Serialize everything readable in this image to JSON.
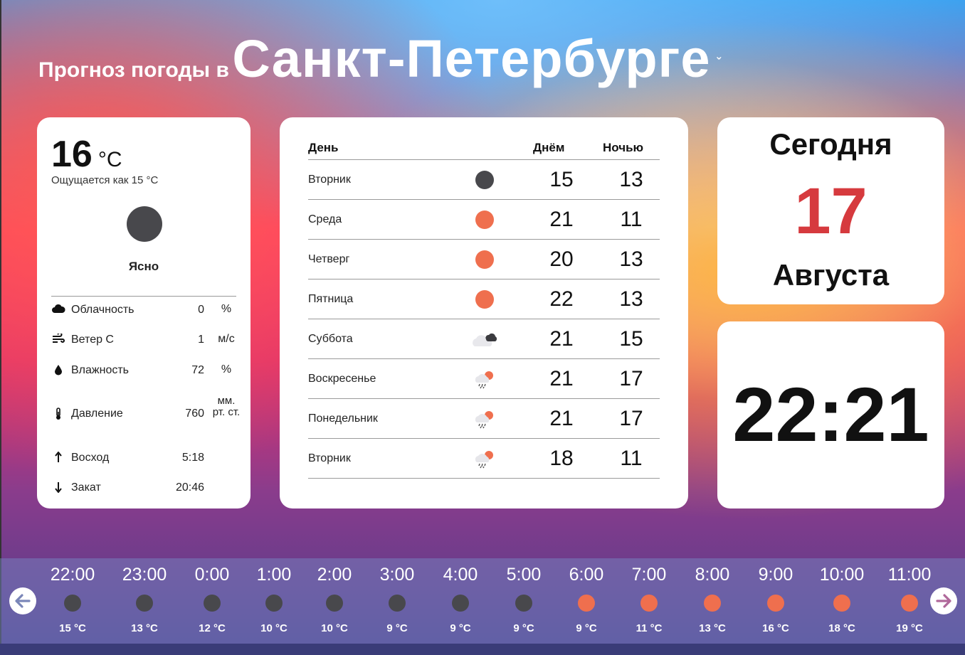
{
  "header": {
    "prefix": "Прогноз погоды в",
    "city": "Санкт-Петербурге",
    "chevron": "ˇ"
  },
  "current": {
    "temp": "16",
    "unit": "°C",
    "feels": "Ощущается как 15 °C",
    "condition": "Ясно",
    "icon": "moon-clear-icon",
    "details": [
      {
        "icon": "cloud-icon",
        "label": "Облачность",
        "value": "0",
        "unit": "%"
      },
      {
        "icon": "wind-icon",
        "label": "Ветер С",
        "value": "1",
        "unit": "м/с"
      },
      {
        "icon": "drop-icon",
        "label": "Влажность",
        "value": "72",
        "unit": "%"
      },
      {
        "icon": "thermometer-icon",
        "label": "Давление",
        "value": "760",
        "unit": "мм. рт. ст."
      },
      {
        "icon": "arrow-up-icon",
        "label": "Восход",
        "value": "5:18",
        "unit": ""
      },
      {
        "icon": "arrow-down-icon",
        "label": "Закат",
        "value": "20:46",
        "unit": ""
      }
    ]
  },
  "forecast": {
    "headers": {
      "day": "День",
      "daytime": "Днём",
      "night": "Ночью"
    },
    "rows": [
      {
        "day": "Вторник",
        "icon": "moon-icon",
        "d": "15",
        "n": "13"
      },
      {
        "day": "Среда",
        "icon": "sun-icon",
        "d": "21",
        "n": "11"
      },
      {
        "day": "Четверг",
        "icon": "sun-icon",
        "d": "20",
        "n": "13"
      },
      {
        "day": "Пятница",
        "icon": "sun-icon",
        "d": "22",
        "n": "13"
      },
      {
        "day": "Суббота",
        "icon": "cloudy-icon",
        "d": "21",
        "n": "15"
      },
      {
        "day": "Воскресенье",
        "icon": "rain-icon",
        "d": "21",
        "n": "17"
      },
      {
        "day": "Понедельник",
        "icon": "rain-icon",
        "d": "21",
        "n": "17"
      },
      {
        "day": "Вторник",
        "icon": "rain-icon",
        "d": "18",
        "n": "11"
      }
    ]
  },
  "date": {
    "today": "Сегодня",
    "day": "17",
    "month": "Августа"
  },
  "time": "22:21",
  "hourly": [
    {
      "time": "22:00",
      "icon": "moon-icon",
      "temp": "15 °C"
    },
    {
      "time": "23:00",
      "icon": "moon-icon",
      "temp": "13 °C"
    },
    {
      "time": "0:00",
      "icon": "moon-icon",
      "temp": "12 °C"
    },
    {
      "time": "1:00",
      "icon": "moon-icon",
      "temp": "10 °C"
    },
    {
      "time": "2:00",
      "icon": "moon-icon",
      "temp": "10 °C"
    },
    {
      "time": "3:00",
      "icon": "moon-icon",
      "temp": "9 °C"
    },
    {
      "time": "4:00",
      "icon": "moon-icon",
      "temp": "9 °C"
    },
    {
      "time": "5:00",
      "icon": "moon-icon",
      "temp": "9 °C"
    },
    {
      "time": "6:00",
      "icon": "sun-icon",
      "temp": "9 °C"
    },
    {
      "time": "7:00",
      "icon": "sun-icon",
      "temp": "11 °C"
    },
    {
      "time": "8:00",
      "icon": "sun-icon",
      "temp": "13 °C"
    },
    {
      "time": "9:00",
      "icon": "sun-icon",
      "temp": "16 °C"
    },
    {
      "time": "10:00",
      "icon": "sun-icon",
      "temp": "18 °C"
    },
    {
      "time": "11:00",
      "icon": "sun-icon",
      "temp": "19 °C"
    }
  ],
  "colors": {
    "moon": "#48484c",
    "sun": "#ef6f4e",
    "accent": "#d63a3e"
  }
}
